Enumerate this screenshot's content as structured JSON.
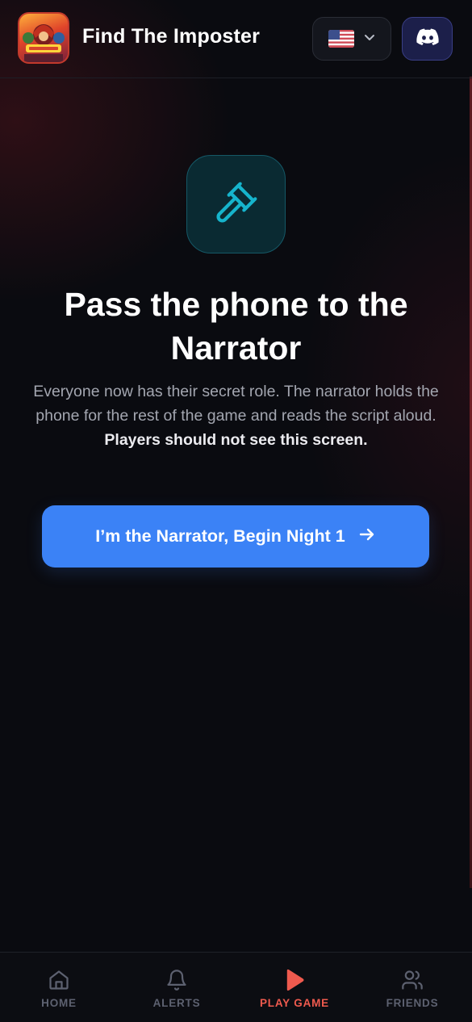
{
  "header": {
    "app_title": "Find The Imposter",
    "logo_icon": "game-logo",
    "language_icon": "us-flag-icon",
    "discord_icon": "discord-icon"
  },
  "main": {
    "hero_icon": "gavel-icon",
    "headline": "Pass the phone to the Narrator",
    "description_plain": "Everyone now has their secret role. The narrator holds the phone for the rest of the game and reads the script aloud. ",
    "description_bold": "Players should not see this screen.",
    "cta_label": "I’m the Narrator, Begin Night 1",
    "cta_icon": "arrow-right-icon"
  },
  "bottom_nav": {
    "items": [
      {
        "label": "HOME",
        "icon": "home-icon",
        "active": false
      },
      {
        "label": "ALERTS",
        "icon": "bell-icon",
        "active": false
      },
      {
        "label": "PLAY GAME",
        "icon": "play-icon",
        "active": true
      },
      {
        "label": "FRIENDS",
        "icon": "users-icon",
        "active": false
      }
    ]
  },
  "colors": {
    "background": "#0a0b10",
    "accent_blue": "#3b82f6",
    "active_red": "#ef5a4e",
    "hero_teal": "#16b4cc",
    "discord_purple": "#1c1f4a"
  }
}
